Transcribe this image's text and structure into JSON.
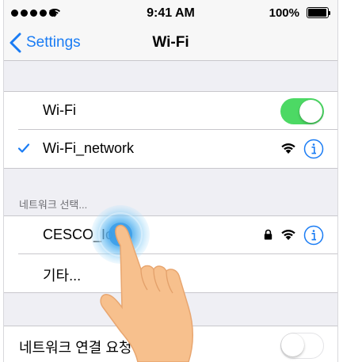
{
  "status_bar": {
    "time": "9:41 AM",
    "battery": "100%",
    "icons": [
      "signal-dots-icon",
      "wifi-signal-icon",
      "battery-icon"
    ]
  },
  "nav_bar": {
    "back_label": "Settings",
    "title": "Wi-Fi"
  },
  "wifi_group": {
    "toggle_label": "Wi-Fi",
    "toggle_on": true,
    "connected_network": "Wi-Fi_network",
    "connected_icons": [
      "checkmark-icon",
      "wifi-strength-icon",
      "info-icon"
    ]
  },
  "networks_section": {
    "header": "네트워크 선택...",
    "networks": [
      {
        "name": "CESCO_IoT",
        "secured": true,
        "icons": [
          "lock-icon",
          "wifi-strength-icon",
          "info-icon"
        ]
      }
    ],
    "other_label": "기타..."
  },
  "ask_group": {
    "label": "네트워크 연결 요청",
    "toggle_on": false
  },
  "colors": {
    "accent_blue": "#1a7cf4",
    "toggle_green": "#4cd964",
    "group_background": "#efeff4",
    "separator": "#c8c7cc",
    "touch_highlight": "#5ab4f0",
    "hand_skin": "#f7c08d"
  },
  "overlay": {
    "touch_indicator_icon": "touch-ripple-icon",
    "hand_icon": "pointing-hand-icon"
  }
}
